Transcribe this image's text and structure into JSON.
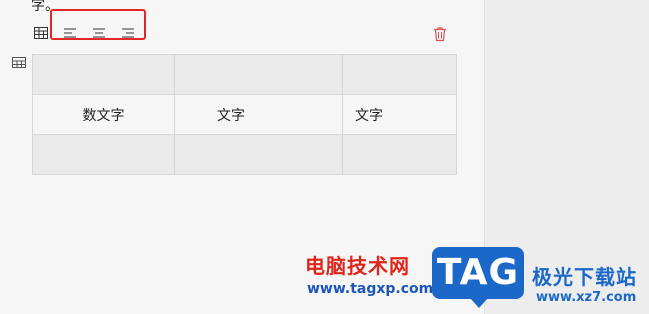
{
  "document": {
    "clipped_text": "字。"
  },
  "toolbar": {
    "icons": [
      "table-properties-icon",
      "align-left-icon",
      "align-center-icon",
      "align-right-icon"
    ],
    "delete_icon": "trash-icon",
    "highlight_color": "#e32626",
    "delete_color": "#d95454"
  },
  "table": {
    "rows": [
      [
        "",
        "",
        ""
      ],
      [
        "数文字",
        "文字",
        "文字"
      ],
      [
        "",
        "",
        ""
      ]
    ],
    "header_shade": "#eaeaea"
  },
  "watermark": {
    "brand": "电脑技术网",
    "url": "www.tagxp.com",
    "badge": "TAG",
    "site_name": "极光下载站",
    "site_url": "www.xz7.com"
  }
}
